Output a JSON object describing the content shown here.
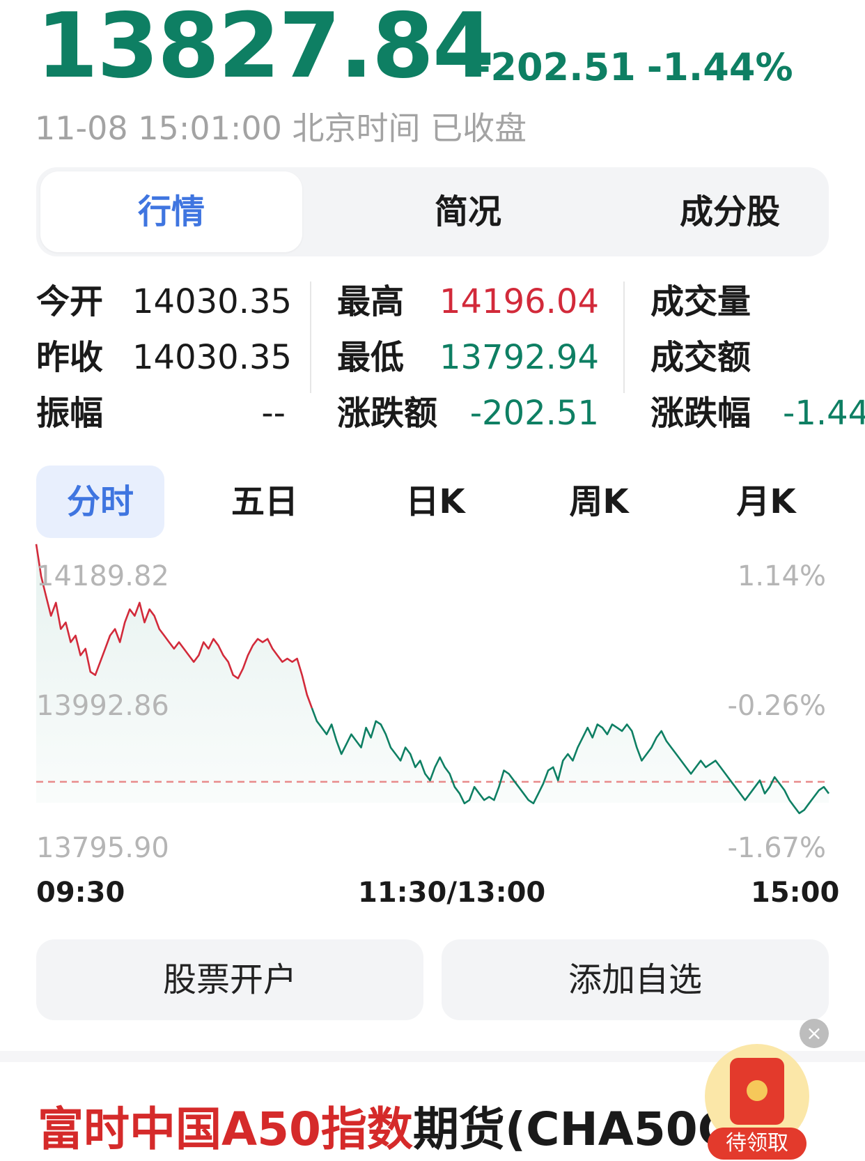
{
  "header": {
    "price": "13827.84",
    "change": "-202.51",
    "change_pct": "-1.44%",
    "time_status": "11-08 15:01:00 北京时间 已收盘"
  },
  "tabs": [
    "行情",
    "简况",
    "成分股"
  ],
  "stats": {
    "open_label": "今开",
    "open_value": "14030.35",
    "prev_close_label": "昨收",
    "prev_close_value": "14030.35",
    "amplitude_label": "振幅",
    "amplitude_value": "--",
    "high_label": "最高",
    "high_value": "14196.04",
    "low_label": "最低",
    "low_value": "13792.94",
    "change_amount_label": "涨跌额",
    "change_amount_value": "-202.51",
    "volume_label": "成交量",
    "turnover_label": "成交额",
    "change_pct_label": "涨跌幅",
    "change_pct_value": "-1.44"
  },
  "period_tabs": [
    "分时",
    "五日",
    "日K",
    "周K",
    "月K"
  ],
  "chart_data": {
    "type": "line",
    "y_left_ticks": [
      "14189.82",
      "13992.86",
      "13795.90"
    ],
    "y_right_ticks": [
      "1.14%",
      "-0.26%",
      "-1.67%"
    ],
    "x_ticks": [
      "09:30",
      "11:30/13:00",
      "15:00"
    ],
    "ylim": [
      13795.9,
      14189.82
    ],
    "reference_value": 13827.84,
    "colors": {
      "above": "#d22a3a",
      "below": "#0e7f63",
      "reference": "#e88a8a"
    },
    "values": [
      14189,
      14140,
      14110,
      14080,
      14100,
      14060,
      14070,
      14040,
      14050,
      14020,
      14030,
      13995,
      13990,
      14010,
      14030,
      14050,
      14060,
      14040,
      14070,
      14090,
      14080,
      14100,
      14070,
      14090,
      14080,
      14060,
      14050,
      14040,
      14030,
      14040,
      14030,
      14020,
      14010,
      14020,
      14040,
      14030,
      14045,
      14035,
      14020,
      14010,
      13990,
      13985,
      14000,
      14020,
      14035,
      14045,
      14040,
      14045,
      14030,
      14020,
      14010,
      14015,
      14010,
      14015,
      13990,
      13960,
      13940,
      13920,
      13910,
      13900,
      13915,
      13890,
      13870,
      13885,
      13900,
      13890,
      13880,
      13910,
      13895,
      13920,
      13915,
      13900,
      13880,
      13870,
      13860,
      13880,
      13870,
      13850,
      13860,
      13840,
      13830,
      13850,
      13865,
      13850,
      13840,
      13820,
      13810,
      13795,
      13800,
      13820,
      13810,
      13800,
      13805,
      13800,
      13820,
      13845,
      13840,
      13830,
      13820,
      13810,
      13800,
      13795,
      13810,
      13825,
      13845,
      13850,
      13830,
      13860,
      13870,
      13860,
      13880,
      13895,
      13910,
      13895,
      13915,
      13910,
      13900,
      13915,
      13910,
      13905,
      13915,
      13905,
      13880,
      13860,
      13870,
      13880,
      13895,
      13905,
      13890,
      13880,
      13870,
      13860,
      13850,
      13840,
      13850,
      13860,
      13850,
      13855,
      13860,
      13850,
      13840,
      13830,
      13820,
      13810,
      13800,
      13810,
      13820,
      13830,
      13810,
      13820,
      13835,
      13825,
      13815,
      13800,
      13790,
      13780,
      13785,
      13795,
      13805,
      13815,
      13820,
      13810
    ]
  },
  "buttons": {
    "open_account": "股票开户",
    "add_watchlist": "添加自选"
  },
  "bottom": {
    "title_red": "富时中国A50指数",
    "title_black": "期货(CHA50CF",
    "redpacket_label": "待领取",
    "close_icon": "×"
  }
}
